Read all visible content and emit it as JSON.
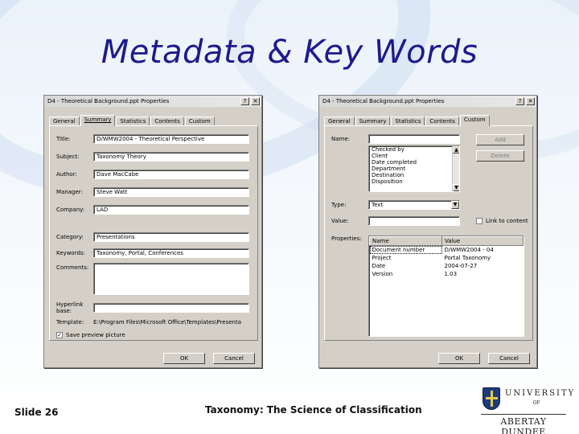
{
  "slide": {
    "title": "Metadata & Key Words",
    "slide_number": "Slide 26",
    "footer": "Taxonomy: The Science of Classification",
    "logo": {
      "line1": "UNIVERSITY",
      "line2": "OF",
      "line3": "ABERTAY DUNDEE"
    }
  },
  "left_dialog": {
    "title": "D4 - Theoretical Background.ppt Properties",
    "help_button": "?",
    "close_button": "✕",
    "tabs": [
      "General",
      "Summary",
      "Statistics",
      "Contents",
      "Custom"
    ],
    "active_tab": "Summary",
    "labels": {
      "title": "Title:",
      "subject": "Subject:",
      "author": "Author:",
      "manager": "Manager:",
      "company": "Company:",
      "category": "Category:",
      "keywords": "Keywords:",
      "comments": "Comments:",
      "hyperlink": "Hyperlink base:",
      "template": "Template:"
    },
    "values": {
      "title": "D/WMW2004 - Theoretical Perspective",
      "subject": "Taxonomy Theory",
      "author": "Dave MacCabe",
      "manager": "Steve Watt",
      "company": "LAD",
      "category": "Presentations",
      "keywords": "Taxonomy, Portal, Conferences",
      "comments": "",
      "hyperlink": "",
      "template": "E:\\Program Files\\Microsoft Office\\Templates\\Presenta"
    },
    "save_preview": "Save preview picture",
    "ok_label": "OK",
    "cancel_label": "Cancel"
  },
  "right_dialog": {
    "title": "D4 - Theoretical Background.ppt Properties",
    "help_button": "?",
    "close_button": "✕",
    "tabs": [
      "General",
      "Summary",
      "Statistics",
      "Contents",
      "Custom"
    ],
    "active_tab": "Custom",
    "labels": {
      "name": "Name:",
      "type": "Type:",
      "value": "Value:",
      "properties": "Properties:"
    },
    "name_value": "",
    "name_list": [
      "Checked by",
      "Client",
      "Date completed",
      "Department",
      "Destination",
      "Disposition"
    ],
    "type_value": "Text",
    "value_value": "",
    "add_label": "Add",
    "delete_label": "Delete",
    "link_label": "Link to content",
    "properties_headers": [
      "Name",
      "Value"
    ],
    "properties_rows": [
      [
        "Document number",
        "D/WMW2004 - 04"
      ],
      [
        "Project",
        "Portal Taxonomy"
      ],
      [
        "Date",
        "2004-07-27"
      ],
      [
        "Version",
        "1.03"
      ]
    ],
    "ok_label": "OK",
    "cancel_label": "Cancel"
  }
}
